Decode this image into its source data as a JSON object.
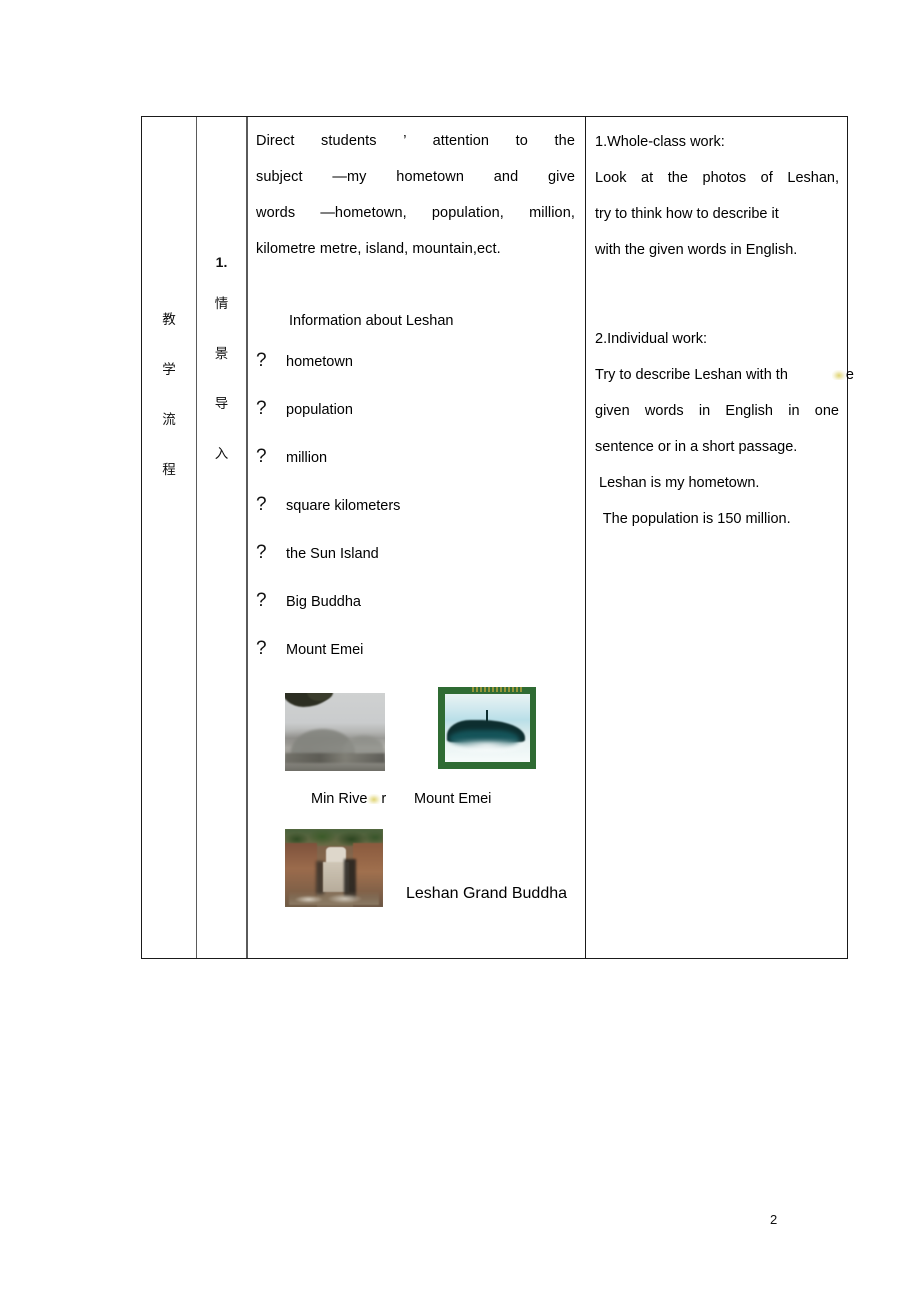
{
  "page": {
    "page_number": "2"
  },
  "table": {
    "stage_column": {
      "label_chars": [
        "教",
        "学",
        "流",
        "程"
      ]
    },
    "step_column": {
      "number": "1.",
      "label_chars": [
        "情",
        "景",
        "导",
        "入"
      ]
    },
    "activity_column": {
      "intro_lines": [
        "Direct students ’ attention to the",
        "subject —my hometown and give",
        "words —hometown,  population,  million,",
        "kilometre metre, island, mountain,ect."
      ],
      "section_title": "Information about Leshan",
      "bullet_glyph": "?",
      "word_list": [
        "hometown",
        "population",
        "million",
        "square kilometers",
        "the Sun Island",
        "Big Buddha",
        "Mount Emei"
      ],
      "photos": [
        {
          "name": "min-river-photo",
          "caption_prefix": "Min Rive",
          "caption_suffix": "r"
        },
        {
          "name": "mount-emei-photo",
          "caption": "Mount Emei"
        },
        {
          "name": "leshan-grand-buddha-photo",
          "caption": "Leshan Grand Buddha"
        }
      ]
    },
    "method_column": {
      "item1_heading": "1.Whole-class work:",
      "item1_lines": [
        "Look at the photos of Leshan,",
        "try to think how to describe it",
        "with  the  given  words in English."
      ],
      "item2_heading": "2.Individual work:",
      "item2_lines": [
        "Try to describe Leshan with th",
        "e",
        "given words in English in one",
        "sentence or in a short passage."
      ],
      "example_sentences": [
        " Leshan is my hometown.",
        "  The population is 150 million."
      ]
    }
  }
}
